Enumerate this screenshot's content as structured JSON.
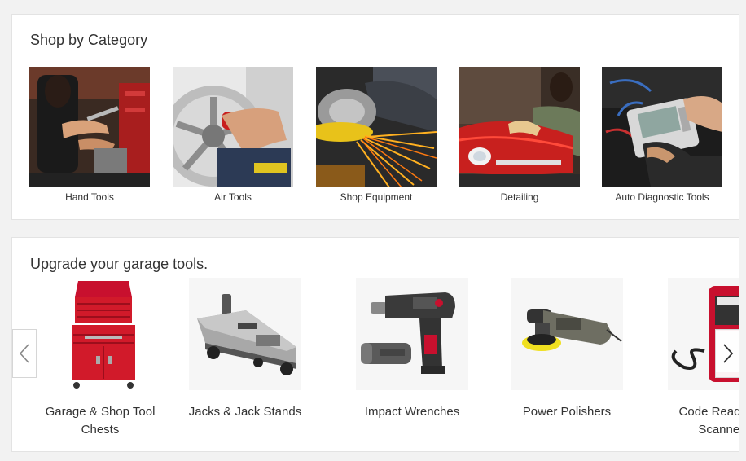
{
  "shop_by_category": {
    "title": "Shop by Category",
    "items": [
      {
        "label": "Hand Tools"
      },
      {
        "label": "Air Tools"
      },
      {
        "label": "Shop Equipment"
      },
      {
        "label": "Detailing"
      },
      {
        "label": "Auto Diagnostic Tools"
      }
    ]
  },
  "upgrade": {
    "title": "Upgrade your garage tools.",
    "items": [
      {
        "label": "Garage & Shop Tool Chests"
      },
      {
        "label": "Jacks & Jack Stands"
      },
      {
        "label": "Impact Wrenches"
      },
      {
        "label": "Power Polishers"
      },
      {
        "label": "Code Readers & Scanners"
      }
    ],
    "prev_icon": "chevron-left-icon",
    "next_icon": "chevron-right-icon"
  },
  "colors": {
    "page_bg": "#f2f2f2",
    "card_bg": "#ffffff",
    "text": "#333333",
    "tool_red": "#c8102e"
  }
}
